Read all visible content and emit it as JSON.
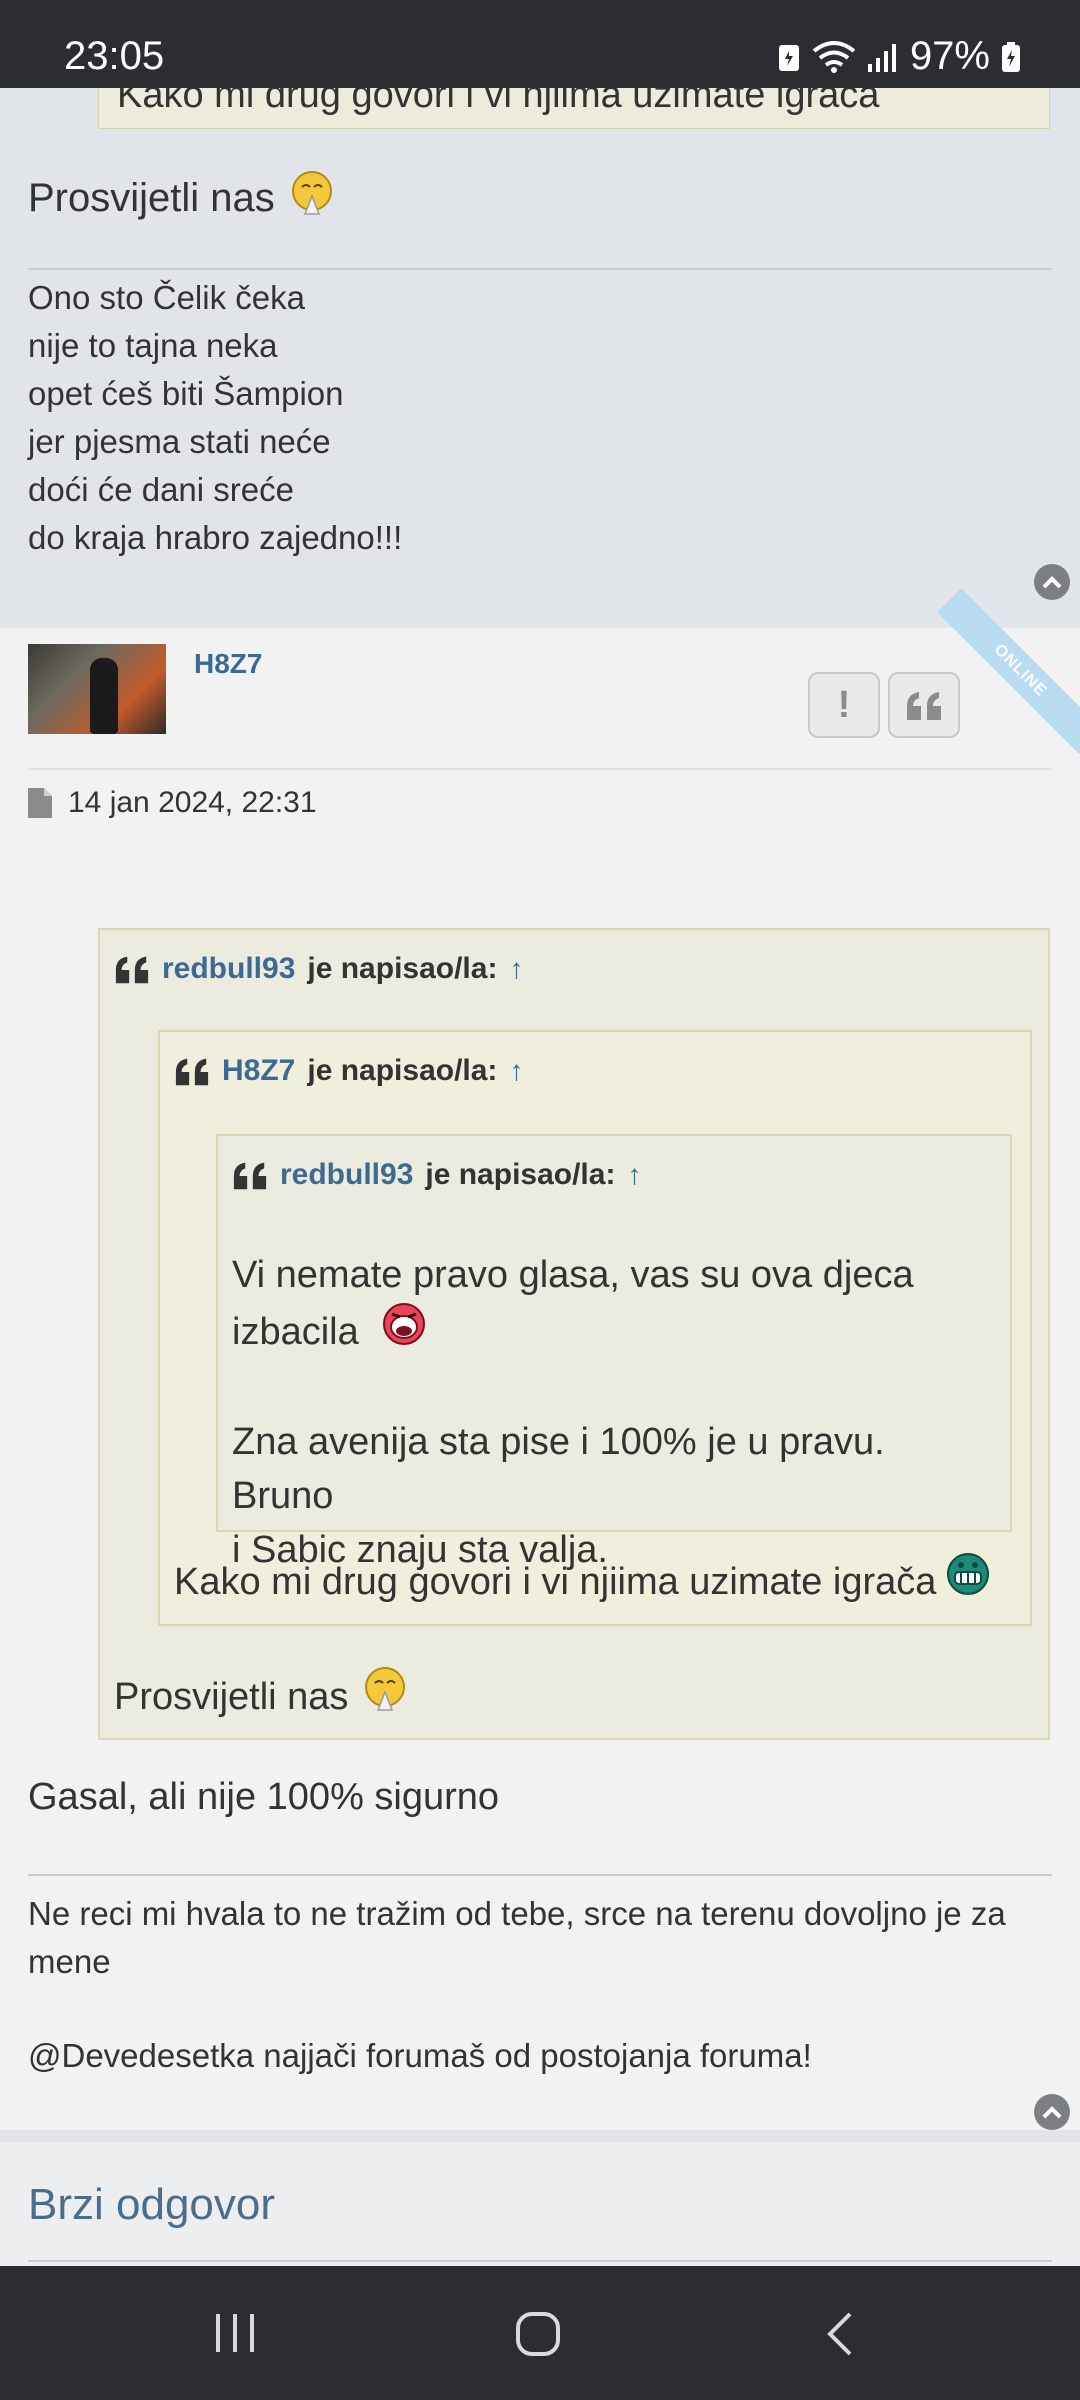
{
  "status_bar": {
    "time": "23:05",
    "battery": "97%"
  },
  "prev_post": {
    "quote_remnant": "Kako mi drug govori i vi njiima uzimate igrača",
    "text": "Prosvijetli nas",
    "signature": [
      "Ono sto Čelik čeka",
      "nije to tajna neka",
      "opet ćeš biti Šampion",
      "jer pjesma stati neće",
      "doći će dani sreće",
      "do kraja hrabro zajedno!!!"
    ]
  },
  "post": {
    "username": "H8Z7",
    "report_icon": "exclamation-icon",
    "quote_icon": "quote-icon",
    "online_badge": "ONLINE",
    "date": "14 jan 2024, 22:31",
    "quote1": {
      "author": "redbull93",
      "wrote": "je napisao/la:",
      "arrow": "↑",
      "text": "Prosvijetli nas",
      "quote2": {
        "author": "H8Z7",
        "wrote": "je napisao/la:",
        "arrow": "↑",
        "text": "Kako mi drug govori i vi njiima uzimate igrača",
        "quote3": {
          "author": "redbull93",
          "wrote": "je napisao/la:",
          "arrow": "↑",
          "para1_line1": "Vi nemate pravo glasa, vas su ova djeca",
          "para1_line2": "izbacila",
          "para2_line1": "Zna avenija sta pise i 100% je u pravu. Bruno",
          "para2_line2": "i Sabic znaju sta valja."
        }
      }
    },
    "body": "Gasal, ali nije 100% sigurno",
    "signature_line1": "Ne reci mi hvala to ne tražim od tebe, srce na terenu dovoljno je za",
    "signature_line2": "mene",
    "signature_line3": "@Devedesetka najjači forumaš od postojanja foruma!"
  },
  "quick_reply": {
    "title": "Brzi odgovor"
  },
  "colors": {
    "link": "#3d6a93",
    "quote_bg": "#ecebdf",
    "online_ribbon": "#b9dcf3"
  }
}
